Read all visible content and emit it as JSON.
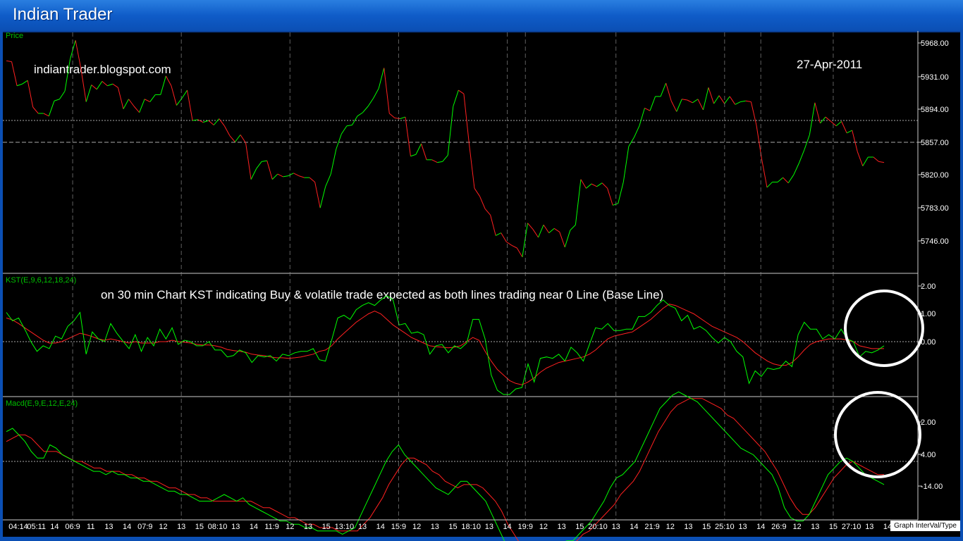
{
  "app": {
    "title": "Indian Trader"
  },
  "price_panel": {
    "label": "Price",
    "blog": "indiantrader.blogspot.com",
    "date": "27-Apr-2011",
    "ticks": [
      "5968.00",
      "5931.00",
      "5894.00",
      "5857.00",
      "5820.00",
      "5783.00",
      "5746.00"
    ]
  },
  "kst_panel": {
    "label": "KST(E,9,6,12,18,24)",
    "annotation": "on 30 min Chart KST indicating Buy & volatile trade expected as both lines trading near 0 Line (Base Line)",
    "ticks": [
      "2.00",
      "1.00",
      "0.00"
    ]
  },
  "macd_panel": {
    "label": "Macd(E,9,E,12,E,24)",
    "ticks": [
      "2.00",
      "4.00",
      "-14.00"
    ]
  },
  "x_axis": {
    "labels": [
      "04:14",
      "05:11",
      "14",
      "06:9",
      "11",
      "13",
      "14",
      "07:9",
      "12",
      "13",
      "15",
      "08:10",
      "13",
      "14",
      "11:9",
      "12",
      "13",
      "15",
      "13:10",
      "13",
      "14",
      "15:9",
      "12",
      "13",
      "15",
      "18:10",
      "13",
      "14",
      "19:9",
      "12",
      "13",
      "15",
      "20:10",
      "13",
      "14",
      "21:9",
      "12",
      "13",
      "15",
      "25:10",
      "13",
      "14",
      "26:9",
      "12",
      "13",
      "15",
      "27:10",
      "13",
      "14"
    ]
  },
  "graph_button": "Graph InterVal/Type",
  "colors": {
    "up": "#00ff00",
    "down": "#ff2020",
    "signal": "#ff2020",
    "fast": "#00ff00",
    "grid": "#aaaaaa"
  },
  "chart_data": [
    {
      "type": "line",
      "name": "price",
      "ylim": [
        5730,
        5975
      ],
      "series": [
        {
          "name": "Price",
          "values": [
            5948,
            5947,
            5920,
            5922,
            5926,
            5896,
            5889,
            5889,
            5886,
            5903,
            5905,
            5914,
            5950,
            5971,
            5940,
            5902,
            5921,
            5916,
            5925,
            5920,
            5922,
            5918,
            5894,
            5905,
            5897,
            5890,
            5905,
            5902,
            5910,
            5910,
            5931,
            5920,
            5898,
            5906,
            5915,
            5881,
            5882,
            5879,
            5881,
            5876,
            5883,
            5875,
            5864,
            5857,
            5865,
            5856,
            5815,
            5827,
            5835,
            5836,
            5815,
            5821,
            5818,
            5819,
            5822,
            5819,
            5817,
            5817,
            5812,
            5783,
            5807,
            5821,
            5849,
            5866,
            5875,
            5876,
            5886,
            5890,
            5897,
            5906,
            5917,
            5940,
            5889,
            5884,
            5883,
            5885,
            5841,
            5843,
            5855,
            5837,
            5837,
            5834,
            5835,
            5842,
            5897,
            5915,
            5911,
            5855,
            5805,
            5796,
            5782,
            5775,
            5752,
            5755,
            5745,
            5741,
            5738,
            5728,
            5766,
            5759,
            5750,
            5764,
            5755,
            5760,
            5756,
            5739,
            5758,
            5764,
            5815,
            5805,
            5810,
            5807,
            5811,
            5805,
            5786,
            5788,
            5812,
            5852,
            5862,
            5875,
            5895,
            5892,
            5908,
            5908,
            5923,
            5903,
            5891,
            5905,
            5904,
            5901,
            5905,
            5893,
            5918,
            5900,
            5909,
            5900,
            5908,
            5899,
            5902,
            5903,
            5902,
            5876,
            5838,
            5806,
            5812,
            5812,
            5817,
            5811,
            5820,
            5833,
            5848,
            5865,
            5901,
            5878,
            5885,
            5880,
            5875,
            5880,
            5867,
            5870,
            5846,
            5830,
            5840,
            5840,
            5835,
            5834
          ]
        }
      ]
    },
    {
      "type": "line",
      "name": "kst",
      "ylim": [
        -2,
        2
      ],
      "series": [
        {
          "name": "KST",
          "values": [
            1.05,
            0.75,
            0.85,
            0.45,
            0.0,
            -0.35,
            -0.15,
            -0.25,
            0.2,
            0.1,
            0.55,
            0.75,
            1.05,
            -0.45,
            0.35,
            0.1,
            0.0,
            0.65,
            0.3,
            0.02,
            -0.25,
            0.25,
            -0.35,
            0.15,
            -0.15,
            0.45,
            0.1,
            0.5,
            -0.1,
            0.05,
            0.0,
            -0.15,
            -0.15,
            0.0,
            -0.3,
            -0.3,
            -0.55,
            -0.5,
            -0.3,
            -0.4,
            -0.75,
            -0.5,
            -0.55,
            -0.5,
            -0.7,
            -0.45,
            -0.5,
            -0.4,
            -0.35,
            -0.35,
            -0.25,
            -0.65,
            -0.7,
            0.05,
            0.85,
            0.95,
            0.8,
            1.15,
            1.3,
            1.4,
            1.3,
            1.5,
            1.65,
            1.5,
            0.6,
            0.65,
            0.3,
            0.35,
            0.25,
            -0.45,
            -0.15,
            -0.1,
            -0.4,
            -0.15,
            -0.25,
            -0.05,
            0.8,
            0.8,
            0.1,
            -1.2,
            -1.75,
            -1.9,
            -1.9,
            -1.7,
            -1.65,
            -0.8,
            -1.45,
            -0.6,
            -0.55,
            -0.6,
            -0.45,
            -0.7,
            -0.2,
            -0.4,
            -0.7,
            -0.1,
            0.5,
            0.45,
            0.65,
            0.4,
            0.4,
            0.45,
            0.45,
            0.9,
            0.9,
            1.05,
            1.3,
            1.5,
            1.3,
            1.2,
            0.75,
            0.95,
            0.45,
            0.55,
            0.4,
            0.15,
            -0.05,
            0.15,
            0.0,
            -0.35,
            -0.55,
            -1.5,
            -1.05,
            -1.25,
            -0.95,
            -1.0,
            -0.95,
            -0.7,
            -0.9,
            0.25,
            0.7,
            0.45,
            0.45,
            0.1,
            0.25,
            0.1,
            0.45,
            0.1,
            0.0,
            -0.55,
            -0.35,
            -0.4,
            -0.3,
            -0.15
          ]
        },
        {
          "name": "Signal",
          "values": [
            0.85,
            0.78,
            0.65,
            0.5,
            0.35,
            0.2,
            0.05,
            -0.05,
            -0.05,
            0.0,
            0.1,
            0.2,
            0.3,
            0.25,
            0.18,
            0.1,
            0.05,
            0.1,
            0.05,
            0.0,
            -0.05,
            0.0,
            -0.05,
            -0.05,
            -0.05,
            0.0,
            0.0,
            0.05,
            0.0,
            -0.02,
            -0.05,
            -0.1,
            -0.12,
            -0.12,
            -0.15,
            -0.2,
            -0.28,
            -0.32,
            -0.35,
            -0.38,
            -0.45,
            -0.48,
            -0.5,
            -0.55,
            -0.58,
            -0.58,
            -0.6,
            -0.58,
            -0.55,
            -0.5,
            -0.45,
            -0.35,
            -0.3,
            -0.15,
            0.1,
            0.3,
            0.5,
            0.7,
            0.85,
            1.0,
            1.1,
            1.0,
            0.8,
            0.6,
            0.45,
            0.3,
            0.15,
            0.05,
            -0.05,
            -0.15,
            -0.18,
            -0.2,
            -0.22,
            -0.2,
            -0.15,
            0.0,
            0.15,
            0.05,
            -0.35,
            -0.7,
            -1.0,
            -1.2,
            -1.4,
            -1.5,
            -1.55,
            -1.45,
            -1.3,
            -1.1,
            -0.95,
            -0.85,
            -0.75,
            -0.7,
            -0.65,
            -0.6,
            -0.55,
            -0.45,
            -0.3,
            -0.1,
            0.1,
            0.2,
            0.25,
            0.3,
            0.35,
            0.5,
            0.65,
            0.8,
            1.0,
            1.2,
            1.35,
            1.3,
            1.2,
            1.1,
            1.0,
            0.85,
            0.7,
            0.55,
            0.45,
            0.35,
            0.25,
            0.15,
            0.0,
            -0.2,
            -0.4,
            -0.55,
            -0.7,
            -0.8,
            -0.85,
            -0.85,
            -0.75,
            -0.55,
            -0.3,
            -0.1,
            0.0,
            0.05,
            0.1,
            0.1,
            0.1,
            0.05,
            0.0,
            -0.15,
            -0.2,
            -0.25,
            -0.25,
            -0.25
          ]
        }
      ]
    },
    {
      "type": "line",
      "name": "macd",
      "ylim": [
        -32,
        26
      ],
      "series": [
        {
          "name": "MACD",
          "values": [
            9,
            10,
            8,
            6,
            3,
            1,
            1,
            5,
            4,
            2,
            1,
            0,
            -1,
            -2,
            -3,
            -3,
            -4,
            -3,
            -4,
            -4,
            -5,
            -5,
            -6,
            -6,
            -7,
            -8,
            -9,
            -9,
            -10,
            -10,
            -11,
            -12,
            -12,
            -12,
            -11,
            -10,
            -11,
            -12,
            -11,
            -13,
            -14,
            -15,
            -16,
            -17,
            -18,
            -18,
            -19,
            -19,
            -20,
            -20,
            -21,
            -21,
            -21,
            -21,
            -22,
            -21,
            -20,
            -16,
            -12,
            -8,
            -4,
            0,
            3,
            5,
            2,
            0,
            -2,
            -4,
            -6,
            -8,
            -9,
            -10,
            -8,
            -6,
            -6,
            -8,
            -10,
            -12,
            -16,
            -20,
            -24,
            -28,
            -30,
            -31,
            -32,
            -31,
            -30,
            -28,
            -26,
            -25,
            -24,
            -24,
            -22,
            -20,
            -18,
            -15,
            -12,
            -8,
            -5,
            -4,
            -2,
            0,
            4,
            8,
            12,
            16,
            18,
            20,
            21,
            20,
            19,
            18,
            16,
            14,
            12,
            10,
            8,
            6,
            4,
            3,
            2,
            0,
            -2,
            -4,
            -8,
            -14,
            -17,
            -18,
            -18,
            -16,
            -12,
            -8,
            -4,
            -2,
            0,
            1,
            0,
            -2,
            -4,
            -5,
            -6,
            -7
          ]
        },
        {
          "name": "Signal",
          "values": [
            6,
            7,
            8,
            8,
            7,
            5,
            3,
            3,
            3,
            2,
            1,
            0,
            0,
            -1,
            -2,
            -2,
            -3,
            -3,
            -3,
            -4,
            -4,
            -5,
            -5,
            -6,
            -6,
            -7,
            -8,
            -8,
            -9,
            -10,
            -10,
            -11,
            -11,
            -12,
            -12,
            -12,
            -12,
            -12,
            -12,
            -12,
            -13,
            -14,
            -14,
            -15,
            -16,
            -17,
            -17,
            -18,
            -19,
            -19,
            -20,
            -20,
            -20,
            -21,
            -21,
            -21,
            -21,
            -19,
            -17,
            -14,
            -11,
            -7,
            -4,
            -1,
            1,
            1,
            0,
            -1,
            -3,
            -4,
            -6,
            -7,
            -8,
            -7,
            -7,
            -7,
            -8,
            -10,
            -12,
            -15,
            -19,
            -22,
            -25,
            -28,
            -29,
            -29,
            -29,
            -28,
            -27,
            -26,
            -25,
            -24,
            -22,
            -21,
            -19,
            -17,
            -15,
            -13,
            -10,
            -8,
            -6,
            -3,
            1,
            5,
            9,
            12,
            15,
            17,
            18,
            19,
            19,
            19,
            18,
            17,
            16,
            14,
            13,
            11,
            9,
            7,
            5,
            3,
            0,
            -3,
            -7,
            -11,
            -14,
            -16,
            -16,
            -14,
            -11,
            -8,
            -5,
            -3,
            -1,
            0,
            -1,
            -2,
            -3,
            -4,
            -4
          ]
        }
      ]
    }
  ]
}
